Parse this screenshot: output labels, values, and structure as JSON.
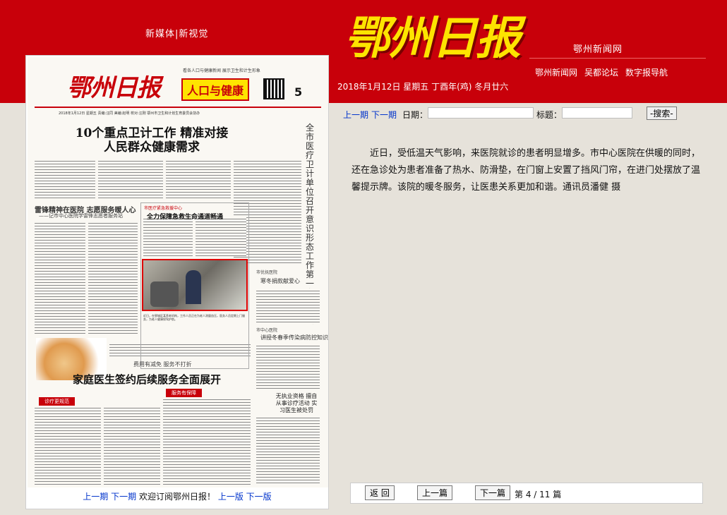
{
  "header": {
    "new_media": "新媒体|新视觉",
    "masthead": "鄂州日报",
    "site_name": "鄂州新闻网",
    "nav": [
      "鄂州新闻网",
      "吴都论坛",
      "数字报导航"
    ],
    "date": "2018年1月12日 星期五 丁酉年(鸡) 冬月廿六"
  },
  "paper": {
    "masthead": "鄂州日报",
    "tagline": "看各人口与健康新闻 展示卫生和计生形象",
    "section": "人口与健康",
    "page_no": "5",
    "info": "2018年1月12日 星期五   责编:汪同   美编:赵明   校对:汪刚   鄂州市卫生和计划生育委员会协办",
    "headline1": "10个重点卫计工作 精准对接人民群众健康需求",
    "vertical": "全市医疗卫计单位召开意识形态工作第一次联席会",
    "h2": "雷锋精神在医院 志愿服务暖人心",
    "h2_sub": "——记市中心医院学雷锋志愿者服务站",
    "box_head": "市医疗紧急救援中心",
    "box_title": "全力保障急救生命通道畅通",
    "photo_caption": "近日，在鄂城区某养老机构，工作人员正在为老人测量血压，医务人员定期上门服务，为老人健康保驾护航。",
    "headline3": "家庭医生签约后续服务全面展开",
    "sub3": "费用有减免  服务不打折",
    "tag1": "诊疗更规范",
    "tag2": "服务有保障",
    "right1": "市优抚医院",
    "right1_h": "寒冬捐款献爱心",
    "right2": "市中心医院",
    "right2_h": "讲授冬春季传染病防控知识",
    "right3_h": "无执业资格 擅自从事诊疗活动 实习医生被处罚",
    "footer_prev": "上一期",
    "footer_next": "下一期",
    "footer_welcome": "欢迎订阅鄂州日报！",
    "footer_prev_page": "上一版",
    "footer_next_page": "下一版"
  },
  "toolbar": {
    "prev": "上一期",
    "next": "下一期",
    "date_label": "日期：",
    "date_value": "",
    "title_label": "标题：",
    "title_value": "",
    "search": "-搜索-"
  },
  "article": {
    "body": "近日，受低温天气影响，来医院就诊的患者明显增多。市中心医院在供暖的同时，还在急诊处为患者准备了热水、防滑垫，在门窗上安置了挡风门帘，在进门处摆放了温馨提示牌。该院的暖冬服务，让医患关系更加和谐。通讯员潘健 摄"
  },
  "bottom": {
    "back": "返 回",
    "prev": "上一篇",
    "next": "下一篇",
    "count": "第 4 / 11 篇"
  },
  "colors": {
    "header_red": "#c8000a",
    "masthead_yellow": "#fde400",
    "link_blue": "#0033cc"
  }
}
